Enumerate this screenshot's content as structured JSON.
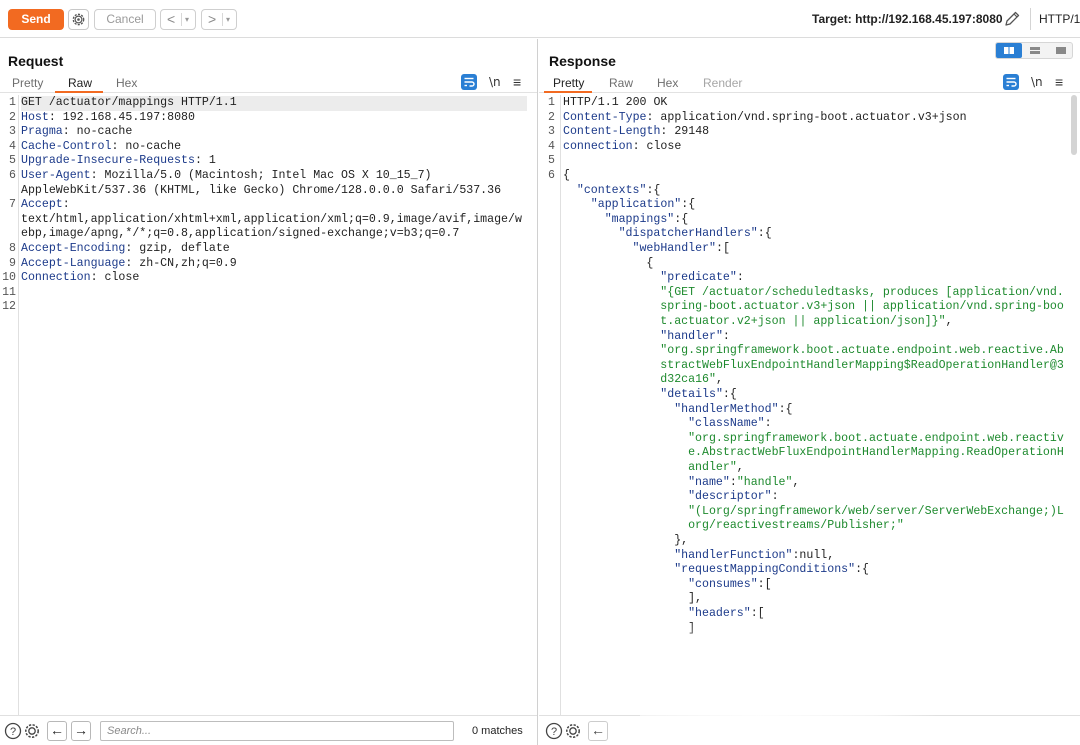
{
  "toolbar": {
    "send_label": "Send",
    "cancel_label": "Cancel",
    "back_arrow": "<",
    "forward_arrow": ">",
    "dropdown_caret": "▾",
    "target_label": "Target: http://192.168.45.197:8080",
    "http_version": "HTTP/1"
  },
  "request": {
    "title": "Request",
    "tabs": [
      "Pretty",
      "Raw",
      "Hex"
    ],
    "active_tab": "Raw",
    "newline_label": "\\n",
    "lines": [
      {
        "n": "1",
        "text": "GET /actuator/mappings HTTP/1.1"
      },
      {
        "n": "2",
        "name": "Host",
        "value": " 192.168.45.197:8080"
      },
      {
        "n": "3",
        "name": "Pragma",
        "value": " no-cache"
      },
      {
        "n": "4",
        "name": "Cache-Control",
        "value": " no-cache"
      },
      {
        "n": "5",
        "name": "Upgrade-Insecure-Requests",
        "value": " 1"
      },
      {
        "n": "6",
        "name": "User-Agent",
        "value": " Mozilla/5.0 (Macintosh; Intel Mac OS X 10_15_7)"
      },
      {
        "n": "",
        "text": "AppleWebKit/537.36 (KHTML, like Gecko) Chrome/128.0.0.0 Safari/537.36"
      },
      {
        "n": "7",
        "name": "Accept",
        "value": ""
      },
      {
        "n": "",
        "text": "text/html,application/xhtml+xml,application/xml;q=0.9,image/avif,image/w"
      },
      {
        "n": "",
        "text": "ebp,image/apng,*/*;q=0.8,application/signed-exchange;v=b3;q=0.7"
      },
      {
        "n": "8",
        "name": "Accept-Encoding",
        "value": " gzip, deflate"
      },
      {
        "n": "9",
        "name": "Accept-Language",
        "value": " zh-CN,zh;q=0.9"
      },
      {
        "n": "10",
        "name": "Connection",
        "value": " close"
      },
      {
        "n": "11",
        "text": ""
      },
      {
        "n": "12",
        "text": ""
      }
    ],
    "search_placeholder": "Search...",
    "matches": "0 matches"
  },
  "response": {
    "title": "Response",
    "tabs": [
      "Pretty",
      "Raw",
      "Hex",
      "Render"
    ],
    "active_tab": "Pretty",
    "newline_label": "\\n",
    "lines": [
      {
        "n": "1",
        "parts": [
          [
            "p",
            "HTTP/1.1 200 OK"
          ]
        ]
      },
      {
        "n": "2",
        "parts": [
          [
            "k",
            "Content-Type"
          ],
          [
            "p",
            ": application/vnd.spring-boot.actuator.v3+json"
          ]
        ]
      },
      {
        "n": "3",
        "parts": [
          [
            "k",
            "Content-Length"
          ],
          [
            "p",
            ": 29148"
          ]
        ]
      },
      {
        "n": "4",
        "parts": [
          [
            "k",
            "connection"
          ],
          [
            "p",
            ": close"
          ]
        ]
      },
      {
        "n": "5",
        "parts": []
      },
      {
        "n": "6",
        "parts": [
          [
            "p",
            "{"
          ]
        ]
      },
      {
        "n": "",
        "indent": 1,
        "parts": [
          [
            "k",
            "\"contexts\""
          ],
          [
            "p",
            ":{"
          ]
        ]
      },
      {
        "n": "",
        "indent": 2,
        "parts": [
          [
            "k",
            "\"application\""
          ],
          [
            "p",
            ":{"
          ]
        ]
      },
      {
        "n": "",
        "indent": 3,
        "parts": [
          [
            "k",
            "\"mappings\""
          ],
          [
            "p",
            ":{"
          ]
        ]
      },
      {
        "n": "",
        "indent": 4,
        "parts": [
          [
            "k",
            "\"dispatcherHandlers\""
          ],
          [
            "p",
            ":{"
          ]
        ]
      },
      {
        "n": "",
        "indent": 5,
        "parts": [
          [
            "k",
            "\"webHandler\""
          ],
          [
            "p",
            ":["
          ]
        ]
      },
      {
        "n": "",
        "indent": 6,
        "parts": [
          [
            "p",
            "{"
          ]
        ]
      },
      {
        "n": "",
        "indent": 7,
        "parts": [
          [
            "k",
            "\"predicate\""
          ],
          [
            "p",
            ":"
          ]
        ]
      },
      {
        "n": "",
        "indent": 7,
        "parts": [
          [
            "s",
            "\"{GET /actuator/scheduledtasks, produces [application/vnd."
          ]
        ]
      },
      {
        "n": "",
        "indent": 7,
        "parts": [
          [
            "s",
            "spring-boot.actuator.v3+json || application/vnd.spring-boo"
          ]
        ]
      },
      {
        "n": "",
        "indent": 7,
        "parts": [
          [
            "s",
            "t.actuator.v2+json || application/json]}\""
          ],
          [
            "p",
            ","
          ]
        ]
      },
      {
        "n": "",
        "indent": 7,
        "parts": [
          [
            "k",
            "\"handler\""
          ],
          [
            "p",
            ":"
          ]
        ]
      },
      {
        "n": "",
        "indent": 7,
        "parts": [
          [
            "s",
            "\"org.springframework.boot.actuate.endpoint.web.reactive.Ab"
          ]
        ]
      },
      {
        "n": "",
        "indent": 7,
        "parts": [
          [
            "s",
            "stractWebFluxEndpointHandlerMapping$ReadOperationHandler@3"
          ]
        ]
      },
      {
        "n": "",
        "indent": 7,
        "parts": [
          [
            "s",
            "d32ca16\""
          ],
          [
            "p",
            ","
          ]
        ]
      },
      {
        "n": "",
        "indent": 7,
        "parts": [
          [
            "k",
            "\"details\""
          ],
          [
            "p",
            ":{"
          ]
        ]
      },
      {
        "n": "",
        "indent": 8,
        "parts": [
          [
            "k",
            "\"handlerMethod\""
          ],
          [
            "p",
            ":{"
          ]
        ]
      },
      {
        "n": "",
        "indent": 9,
        "parts": [
          [
            "k",
            "\"className\""
          ],
          [
            "p",
            ":"
          ]
        ]
      },
      {
        "n": "",
        "indent": 9,
        "parts": [
          [
            "s",
            "\"org.springframework.boot.actuate.endpoint.web.reactiv"
          ]
        ]
      },
      {
        "n": "",
        "indent": 9,
        "parts": [
          [
            "s",
            "e.AbstractWebFluxEndpointHandlerMapping.ReadOperationH"
          ]
        ]
      },
      {
        "n": "",
        "indent": 9,
        "parts": [
          [
            "s",
            "andler\""
          ],
          [
            "p",
            ","
          ]
        ]
      },
      {
        "n": "",
        "indent": 9,
        "parts": [
          [
            "k",
            "\"name\""
          ],
          [
            "p",
            ":"
          ],
          [
            "s",
            "\"handle\""
          ],
          [
            "p",
            ","
          ]
        ]
      },
      {
        "n": "",
        "indent": 9,
        "parts": [
          [
            "k",
            "\"descriptor\""
          ],
          [
            "p",
            ":"
          ]
        ]
      },
      {
        "n": "",
        "indent": 9,
        "parts": [
          [
            "s",
            "\"(Lorg/springframework/web/server/ServerWebExchange;)L"
          ]
        ]
      },
      {
        "n": "",
        "indent": 9,
        "parts": [
          [
            "s",
            "org/reactivestreams/Publisher;\""
          ]
        ]
      },
      {
        "n": "",
        "indent": 8,
        "parts": [
          [
            "p",
            "},"
          ]
        ]
      },
      {
        "n": "",
        "indent": 8,
        "parts": [
          [
            "k",
            "\"handlerFunction\""
          ],
          [
            "p",
            ":null,"
          ]
        ]
      },
      {
        "n": "",
        "indent": 8,
        "parts": [
          [
            "k",
            "\"requestMappingConditions\""
          ],
          [
            "p",
            ":{"
          ]
        ]
      },
      {
        "n": "",
        "indent": 9,
        "parts": [
          [
            "k",
            "\"consumes\""
          ],
          [
            "p",
            ":["
          ]
        ]
      },
      {
        "n": "",
        "indent": 9,
        "parts": [
          [
            "p",
            "],"
          ]
        ]
      },
      {
        "n": "",
        "indent": 9,
        "parts": [
          [
            "k",
            "\"headers\""
          ],
          [
            "p",
            ":["
          ]
        ]
      },
      {
        "n": "",
        "indent": 9,
        "parts": [
          [
            "p",
            "]"
          ]
        ]
      }
    ]
  },
  "colors": {
    "accent": "#f26a21",
    "toggle_blue": "#2a7fd4",
    "header_name": "#1c3a8a",
    "json_string": "#1e8a2e"
  },
  "icons": [
    "settings-gear-icon",
    "pencil-edit-icon",
    "wrap-lines-icon",
    "newline-icon",
    "hamburger-menu-icon",
    "help-icon",
    "arrow-left-icon",
    "arrow-right-icon",
    "layout-toggle-icon"
  ]
}
